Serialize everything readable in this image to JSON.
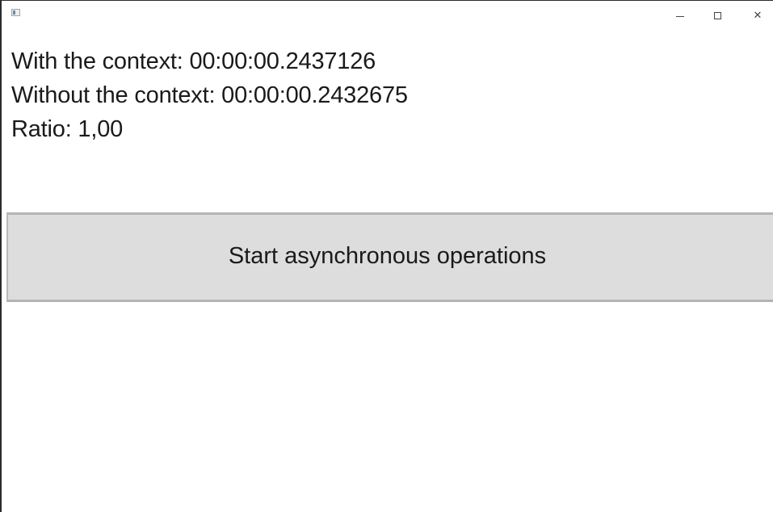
{
  "window": {
    "title": "",
    "controls": {
      "minimize": "minimize-icon",
      "maximize": "maximize-icon",
      "close": "✕"
    }
  },
  "results": {
    "with_context": "With the context: 00:00:00.2437126",
    "without_context": "Without the context: 00:00:00.2432675",
    "ratio": "Ratio: 1,00"
  },
  "actions": {
    "start_label": "Start asynchronous operations"
  },
  "colors": {
    "button_background": "#dddddd",
    "button_border": "#b4b4b4",
    "text": "#1a1a1a"
  }
}
